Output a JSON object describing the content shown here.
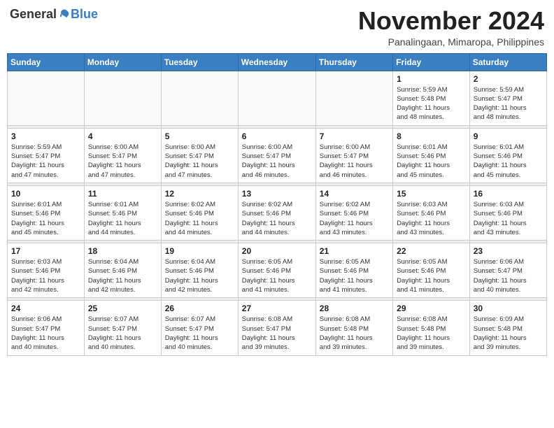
{
  "logo": {
    "general": "General",
    "blue": "Blue"
  },
  "title": "November 2024",
  "location": "Panalingaan, Mimaropa, Philippines",
  "days_of_week": [
    "Sunday",
    "Monday",
    "Tuesday",
    "Wednesday",
    "Thursday",
    "Friday",
    "Saturday"
  ],
  "weeks": [
    [
      {
        "day": "",
        "info": ""
      },
      {
        "day": "",
        "info": ""
      },
      {
        "day": "",
        "info": ""
      },
      {
        "day": "",
        "info": ""
      },
      {
        "day": "",
        "info": ""
      },
      {
        "day": "1",
        "info": "Sunrise: 5:59 AM\nSunset: 5:48 PM\nDaylight: 11 hours\nand 48 minutes."
      },
      {
        "day": "2",
        "info": "Sunrise: 5:59 AM\nSunset: 5:47 PM\nDaylight: 11 hours\nand 48 minutes."
      }
    ],
    [
      {
        "day": "3",
        "info": "Sunrise: 5:59 AM\nSunset: 5:47 PM\nDaylight: 11 hours\nand 47 minutes."
      },
      {
        "day": "4",
        "info": "Sunrise: 6:00 AM\nSunset: 5:47 PM\nDaylight: 11 hours\nand 47 minutes."
      },
      {
        "day": "5",
        "info": "Sunrise: 6:00 AM\nSunset: 5:47 PM\nDaylight: 11 hours\nand 47 minutes."
      },
      {
        "day": "6",
        "info": "Sunrise: 6:00 AM\nSunset: 5:47 PM\nDaylight: 11 hours\nand 46 minutes."
      },
      {
        "day": "7",
        "info": "Sunrise: 6:00 AM\nSunset: 5:47 PM\nDaylight: 11 hours\nand 46 minutes."
      },
      {
        "day": "8",
        "info": "Sunrise: 6:01 AM\nSunset: 5:46 PM\nDaylight: 11 hours\nand 45 minutes."
      },
      {
        "day": "9",
        "info": "Sunrise: 6:01 AM\nSunset: 5:46 PM\nDaylight: 11 hours\nand 45 minutes."
      }
    ],
    [
      {
        "day": "10",
        "info": "Sunrise: 6:01 AM\nSunset: 5:46 PM\nDaylight: 11 hours\nand 45 minutes."
      },
      {
        "day": "11",
        "info": "Sunrise: 6:01 AM\nSunset: 5:46 PM\nDaylight: 11 hours\nand 44 minutes."
      },
      {
        "day": "12",
        "info": "Sunrise: 6:02 AM\nSunset: 5:46 PM\nDaylight: 11 hours\nand 44 minutes."
      },
      {
        "day": "13",
        "info": "Sunrise: 6:02 AM\nSunset: 5:46 PM\nDaylight: 11 hours\nand 44 minutes."
      },
      {
        "day": "14",
        "info": "Sunrise: 6:02 AM\nSunset: 5:46 PM\nDaylight: 11 hours\nand 43 minutes."
      },
      {
        "day": "15",
        "info": "Sunrise: 6:03 AM\nSunset: 5:46 PM\nDaylight: 11 hours\nand 43 minutes."
      },
      {
        "day": "16",
        "info": "Sunrise: 6:03 AM\nSunset: 5:46 PM\nDaylight: 11 hours\nand 43 minutes."
      }
    ],
    [
      {
        "day": "17",
        "info": "Sunrise: 6:03 AM\nSunset: 5:46 PM\nDaylight: 11 hours\nand 42 minutes."
      },
      {
        "day": "18",
        "info": "Sunrise: 6:04 AM\nSunset: 5:46 PM\nDaylight: 11 hours\nand 42 minutes."
      },
      {
        "day": "19",
        "info": "Sunrise: 6:04 AM\nSunset: 5:46 PM\nDaylight: 11 hours\nand 42 minutes."
      },
      {
        "day": "20",
        "info": "Sunrise: 6:05 AM\nSunset: 5:46 PM\nDaylight: 11 hours\nand 41 minutes."
      },
      {
        "day": "21",
        "info": "Sunrise: 6:05 AM\nSunset: 5:46 PM\nDaylight: 11 hours\nand 41 minutes."
      },
      {
        "day": "22",
        "info": "Sunrise: 6:05 AM\nSunset: 5:46 PM\nDaylight: 11 hours\nand 41 minutes."
      },
      {
        "day": "23",
        "info": "Sunrise: 6:06 AM\nSunset: 5:47 PM\nDaylight: 11 hours\nand 40 minutes."
      }
    ],
    [
      {
        "day": "24",
        "info": "Sunrise: 6:06 AM\nSunset: 5:47 PM\nDaylight: 11 hours\nand 40 minutes."
      },
      {
        "day": "25",
        "info": "Sunrise: 6:07 AM\nSunset: 5:47 PM\nDaylight: 11 hours\nand 40 minutes."
      },
      {
        "day": "26",
        "info": "Sunrise: 6:07 AM\nSunset: 5:47 PM\nDaylight: 11 hours\nand 40 minutes."
      },
      {
        "day": "27",
        "info": "Sunrise: 6:08 AM\nSunset: 5:47 PM\nDaylight: 11 hours\nand 39 minutes."
      },
      {
        "day": "28",
        "info": "Sunrise: 6:08 AM\nSunset: 5:48 PM\nDaylight: 11 hours\nand 39 minutes."
      },
      {
        "day": "29",
        "info": "Sunrise: 6:08 AM\nSunset: 5:48 PM\nDaylight: 11 hours\nand 39 minutes."
      },
      {
        "day": "30",
        "info": "Sunrise: 6:09 AM\nSunset: 5:48 PM\nDaylight: 11 hours\nand 39 minutes."
      }
    ]
  ]
}
